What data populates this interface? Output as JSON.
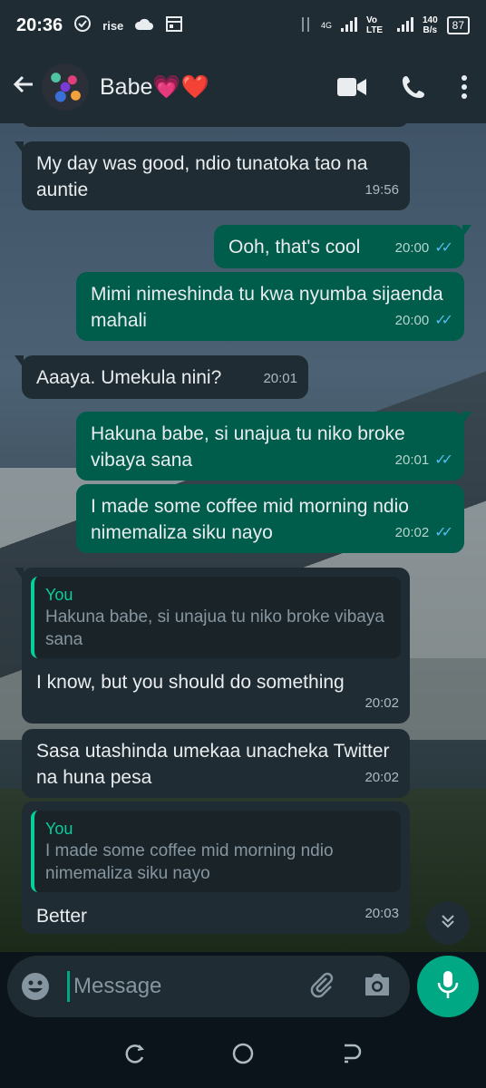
{
  "status_bar": {
    "time": "20:36",
    "rise_label": "rise",
    "network_4g": "4G",
    "network_volte": "Vo LTE",
    "speed_value": "140",
    "speed_unit": "B/s",
    "battery": "87"
  },
  "header": {
    "contact_name": "Babe💗❤️",
    "icons": [
      "back-arrow-icon",
      "video-call-icon",
      "phone-icon",
      "more-vert-icon"
    ]
  },
  "messages": [
    {
      "dir": "in",
      "text": "My day was good, ndio tunatoka tao na auntie",
      "time": "19:56"
    },
    {
      "dir": "out",
      "text": "Ooh, that's cool",
      "time": "20:00",
      "read": true
    },
    {
      "dir": "out",
      "text": "Mimi nimeshinda tu kwa nyumba sijaenda mahali",
      "time": "20:00",
      "read": true
    },
    {
      "dir": "in",
      "text": "Aaaya. Umekula nini?",
      "time": "20:01"
    },
    {
      "dir": "out",
      "text": "Hakuna babe, si unajua tu niko broke vibaya sana",
      "time": "20:01",
      "read": true
    },
    {
      "dir": "out",
      "text": "I made some coffee mid morning ndio nimemaliza siku nayo",
      "time": "20:02",
      "read": true
    },
    {
      "dir": "in",
      "quote_author": "You",
      "quote_text": "Hakuna babe, si unajua tu niko broke vibaya sana",
      "text": "I know, but you should do something",
      "time": "20:02"
    },
    {
      "dir": "in",
      "text": "Sasa utashinda umekaa unacheka Twitter na huna pesa",
      "time": "20:02"
    },
    {
      "dir": "in",
      "quote_author": "You",
      "quote_text": "I made some coffee mid morning ndio nimemaliza siku nayo",
      "text": "Better",
      "time": "20:03"
    }
  ],
  "composer": {
    "placeholder": "Message"
  },
  "colors": {
    "incoming_bubble": "#202c33",
    "outgoing_bubble": "#005c4b",
    "accent": "#00a884",
    "read_tick": "#53bdeb"
  }
}
